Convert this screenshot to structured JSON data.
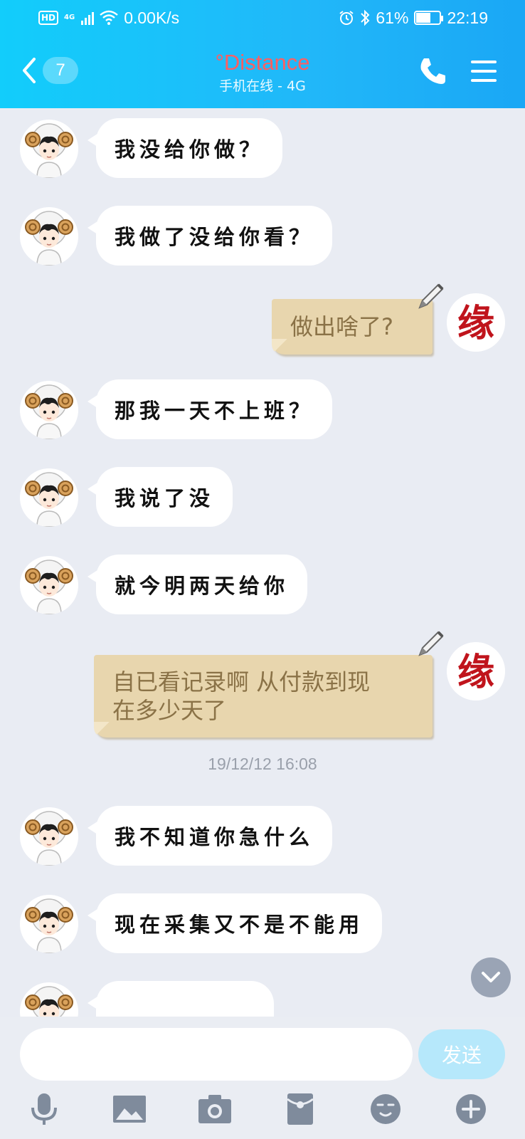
{
  "status_bar": {
    "hd": "HD",
    "net": "4G",
    "speed": "0.00K/s",
    "battery": "61%",
    "battery_level": 0.61,
    "time": "22:19"
  },
  "header": {
    "back_count": "7",
    "title": "°Distance",
    "subtitle": "手机在线 - 4G"
  },
  "messages": [
    {
      "side": "in",
      "text": "我没给你做？"
    },
    {
      "side": "in",
      "text": "我做了没给你看？"
    },
    {
      "side": "out",
      "text": "做出啥了?"
    },
    {
      "side": "in",
      "text": "那我一天不上班？"
    },
    {
      "side": "in",
      "text": "我说了没"
    },
    {
      "side": "in",
      "text": "就今明两天给你"
    },
    {
      "side": "out",
      "lines": [
        "自已看记录啊  从付款到现",
        "在多少天了"
      ]
    },
    {
      "side": "time",
      "text": "19/12/12 16:08"
    },
    {
      "side": "in",
      "text": "我不知道你急什么"
    },
    {
      "side": "in",
      "text": "现在采集又不是不能用"
    }
  ],
  "self_avatar_glyph": "缘",
  "input": {
    "placeholder": "",
    "send_label": "发送"
  },
  "colors": {
    "header_start": "#12cdfb",
    "header_end": "#1aa7f5",
    "title": "#ff5f62",
    "out_bubble": "#e8d6ae",
    "out_text": "#8a7247",
    "self_avatar": "#c0141c"
  }
}
